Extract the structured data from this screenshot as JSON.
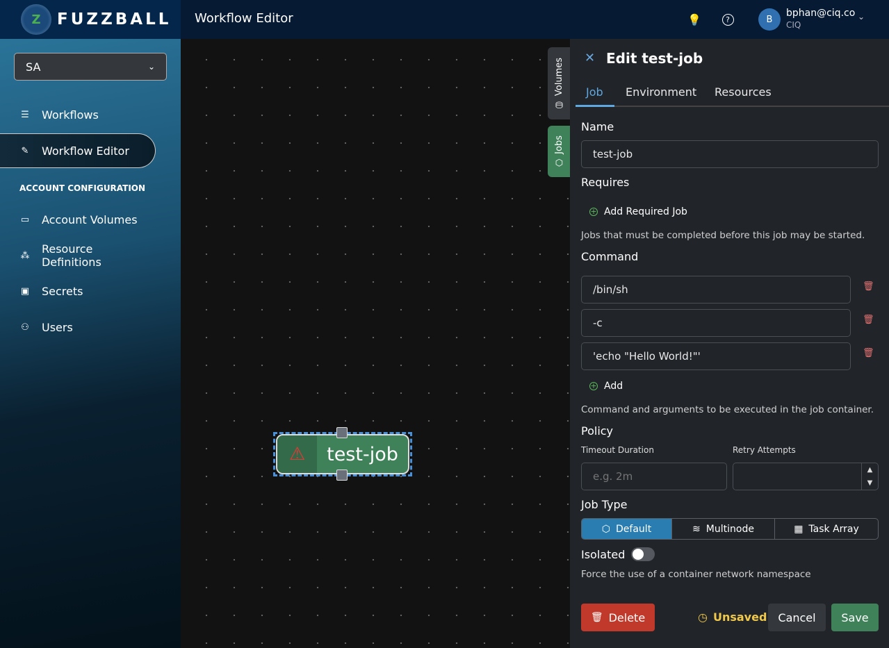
{
  "app": {
    "brand": "FUZZBALL",
    "page_title": "Workflow Editor"
  },
  "header": {
    "theme_icon": "lightbulb-icon",
    "help_icon": "help-circle-icon",
    "user": {
      "avatar_letter": "B",
      "email": "bphan@ciq.co",
      "org": "CIQ"
    }
  },
  "sidebar": {
    "org_select": {
      "value": "SA"
    },
    "items": [
      {
        "label": "Workflows",
        "icon": "list-icon"
      },
      {
        "label": "Workflow Editor",
        "icon": "edit-icon",
        "active": true
      }
    ],
    "account_heading": "ACCOUNT CONFIGURATION",
    "account_items": [
      {
        "label": "Account Volumes",
        "icon": "drive-icon"
      },
      {
        "label": "Resource Definitions",
        "icon": "hierarchy-icon"
      },
      {
        "label": "Secrets",
        "icon": "secret-icon"
      },
      {
        "label": "Users",
        "icon": "users-icon"
      }
    ]
  },
  "canvas": {
    "side_tabs": [
      {
        "label": "Volumes"
      },
      {
        "label": "Jobs",
        "active": true
      }
    ],
    "node": {
      "label": "test-job",
      "status": "warning"
    }
  },
  "panel": {
    "title": "Edit test-job",
    "tabs": [
      "Job",
      "Environment",
      "Resources"
    ],
    "active_tab": "Job",
    "name_label": "Name",
    "name_value": "test-job",
    "requires_label": "Requires",
    "add_required_job": "Add Required Job",
    "requires_help": "Jobs that must be completed before this job may be started.",
    "command_label": "Command",
    "command_args": [
      "/bin/sh",
      "-c",
      "'echo \"Hello World!\"'"
    ],
    "add_label": "Add",
    "command_help": "Command and arguments to be executed in the job container.",
    "policy_label": "Policy",
    "timeout_label": "Timeout Duration",
    "timeout_placeholder": "e.g. 2m",
    "retry_label": "Retry Attempts",
    "retry_value": "",
    "job_type_label": "Job Type",
    "job_types": [
      "Default",
      "Multinode",
      "Task Array"
    ],
    "job_type_selected": "Default",
    "isolated_label": "Isolated",
    "isolated_on": false,
    "isolated_help": "Force the use of a container network namespace",
    "delete_label": "Delete",
    "unsaved_label": "Unsaved",
    "cancel_label": "Cancel",
    "save_label": "Save"
  },
  "colors": {
    "accent": "#2a7db0",
    "save": "#3f8159",
    "delete": "#c0392b",
    "unsaved": "#f0c94a"
  }
}
